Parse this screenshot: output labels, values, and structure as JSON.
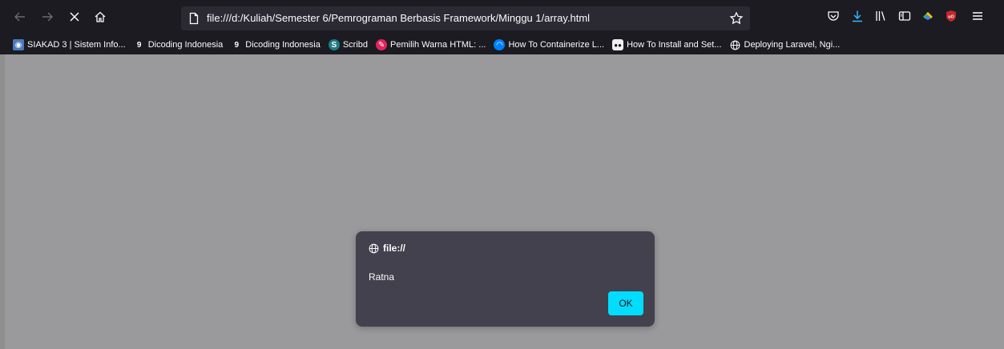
{
  "toolbar": {
    "back_icon": "arrow-left-icon",
    "forward_icon": "arrow-right-icon",
    "stop_icon": "close-icon",
    "home_icon": "home-icon",
    "url": "file:///d:/Kuliah/Semester 6/Pemrograman Berbasis Framework/Minggu 1/array.html",
    "right_icons": [
      "pocket-icon",
      "download-icon",
      "library-icon",
      "sidebar-icon",
      "extension-icon",
      "ublock-icon",
      "menu-icon"
    ]
  },
  "bookmarks": [
    {
      "label": "SIAKAD 3 | Sistem Info...",
      "icon": "siakad-icon",
      "color": "#4a7bbf"
    },
    {
      "label": "Dicoding Indonesia",
      "icon": "dicoding-icon",
      "color": "#2d3e50"
    },
    {
      "label": "Dicoding Indonesia",
      "icon": "dicoding-icon",
      "color": "#2d3e50"
    },
    {
      "label": "Scribd",
      "icon": "scribd-icon",
      "color": "#1e7b85"
    },
    {
      "label": "Pemilih Warna HTML: ...",
      "icon": "color-picker-icon",
      "color": "#e0245e"
    },
    {
      "label": "How To Containerize L...",
      "icon": "digitalocean-icon",
      "color": "#0080ff"
    },
    {
      "label": "How To Install and Set...",
      "icon": "medium-icon",
      "color": "#111111"
    },
    {
      "label": "Deploying Laravel, Ngi...",
      "icon": "globe-icon",
      "color": "#1c1b22"
    }
  ],
  "dialog": {
    "origin": "file://",
    "message": "Ratna",
    "ok_label": "OK"
  },
  "colors": {
    "chrome_bg": "#1c1b22",
    "urlbar_bg": "#2b2a33",
    "dialog_bg": "#42414d",
    "accent": "#00ddff",
    "overlay": "#9a9a9c"
  }
}
